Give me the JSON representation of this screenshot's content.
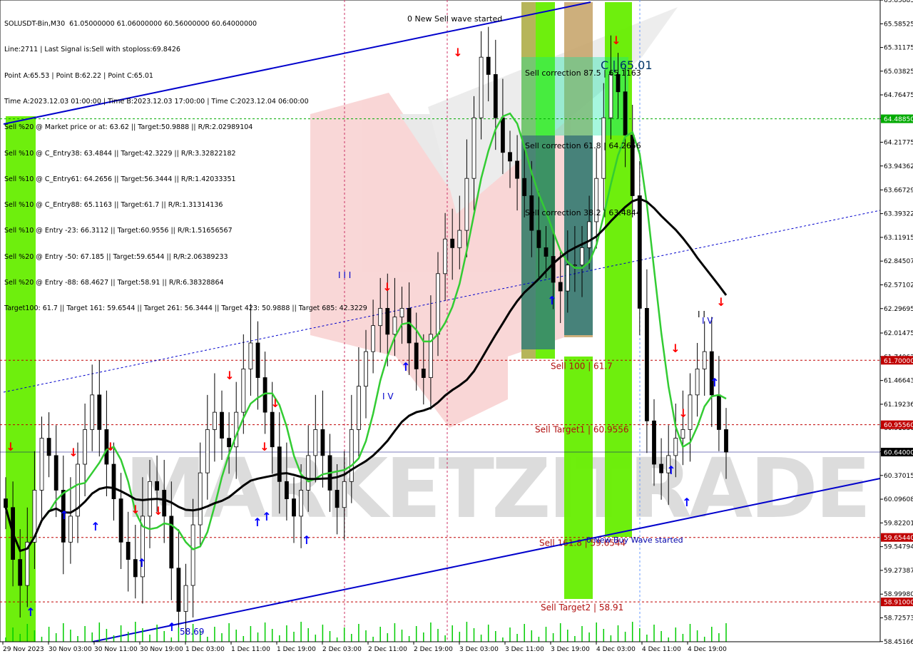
{
  "header": {
    "lines": [
      "SOLUSDT-Bin,M30  61.05000000 61.06000000 60.56000000 60.64000000",
      "Line:2711 | Last Signal is:Sell with stoploss:69.8426",
      "Point A:65.53 | Point B:62.22 | Point C:65.01",
      "Time A:2023.12.03 01:00:00 | Time B:2023.12.03 17:00:00 | Time C:2023.12.04 06:00:00",
      "Sell %20 @ Market price or at: 63.62 || Target:50.9888 || R/R:2.02989104",
      "Sell %10 @ C_Entry38: 63.4844 || Target:42.3229 || R/R:3.32822182",
      "Sell %10 @ C_Entry61: 64.2656 || Target:56.3444 || R/R:1.42033351",
      "Sell %10 @ C_Entry88: 65.1163 || Target:61.7 || R/R:1.31314136",
      "Sell %10 @ Entry -23: 66.3112 || Target:60.9556 || R/R:1.51656567",
      "Sell %20 @ Entry -50: 67.185 || Target:59.6544 || R/R:2.06389233",
      "Sell %20 @ Entry -88: 68.4627 || Target:58.91 || R/R:6.38328864",
      "Target100: 61.7 || Target 161: 59.6544 || Target 261: 56.3444 || Target 423: 50.9888 || Target 685: 42.3229"
    ]
  },
  "watermark": {
    "text": "MARKETZITRADE"
  },
  "colors": {
    "bg": "#ffffff",
    "bull": "#00a000",
    "bear": "#ff0000",
    "wick": "#000000",
    "green_band": "#66ee00",
    "tan_band": "#c8a66e",
    "teal_band": "#2f7a7a",
    "ma_fast": "#33cc33",
    "ma_slow": "#000000",
    "channel": "#0000cc",
    "level_red": "#c00000",
    "level_green": "#00aa00",
    "arrow_up": "#0000ff",
    "arrow_down": "#ff0000"
  },
  "chart_data": {
    "type": "candlestick",
    "symbol": "SOLUSDT-Bin",
    "timeframe": "M30",
    "ylim": [
      58.45,
      65.86
    ],
    "y_ticks": [
      "65.858850",
      "65.585250",
      "65.311750",
      "65.038250",
      "64.764750",
      "64.491250",
      "64.217750",
      "63.943625",
      "63.667299",
      "63.393225",
      "63.119150",
      "62.845075",
      "62.571025",
      "62.296950",
      "62.014750",
      "61.740675",
      "61.466430",
      "61.192365",
      "60.918300",
      "60.644225",
      "60.370155",
      "60.096080",
      "59.822010",
      "59.547940",
      "59.273870",
      "58.999800",
      "58.725735",
      "58.451665"
    ],
    "x_labels": [
      "29 Nov 2023",
      "30 Nov 03:00",
      "30 Nov 11:00",
      "30 Nov 19:00",
      "1 Dec 03:00",
      "1 Dec 11:00",
      "1 Dec 19:00",
      "2 Dec 03:00",
      "2 Dec 11:00",
      "2 Dec 19:00",
      "3 Dec 03:00",
      "3 Dec 11:00",
      "3 Dec 19:00",
      "4 Dec 03:00",
      "4 Dec 11:00",
      "4 Dec 19:00"
    ],
    "price_tags": [
      {
        "label": "61.70000",
        "value": 61.7,
        "color": "#c00000"
      },
      {
        "label": "60.95560",
        "value": 60.9556,
        "color": "#c00000"
      },
      {
        "label": "60.64000",
        "value": 60.64,
        "color": "#000000"
      },
      {
        "label": "59.65440",
        "value": 59.6544,
        "color": "#c00000"
      },
      {
        "label": "58.91000",
        "value": 58.91,
        "color": "#c00000"
      },
      {
        "label": "64.48850",
        "value": 64.4885,
        "color": "#00aa00"
      }
    ],
    "levels": [
      {
        "value": 61.7,
        "color": "#c00000",
        "label": "Sell 100 | 61.7"
      },
      {
        "value": 60.9556,
        "color": "#c00000",
        "label": "Sell Target1 | 60.9556"
      },
      {
        "value": 60.64,
        "color": "#000080",
        "label": ""
      },
      {
        "value": 59.6544,
        "color": "#c00000",
        "label": "Sell 161.8 | 59.6544"
      },
      {
        "value": 58.91,
        "color": "#c00000",
        "label": "Sell Target2 | 58.91"
      },
      {
        "value": 64.4885,
        "color": "#00aa00",
        "label": ""
      }
    ],
    "annotations": [
      {
        "text": "0 New Sell wave started"
      },
      {
        "text": "Sell correction 87.5 | 65.1163"
      },
      {
        "text": "Sell correction 61.8 | 64.2656"
      },
      {
        "text": "Sell correction 38.2 | 63.4844"
      },
      {
        "text": "C | 65.01"
      },
      {
        "text": "0 New Buy Wave started"
      },
      {
        "text": "I V"
      },
      {
        "text": "I I"
      },
      {
        "text": "I V"
      },
      {
        "text": "I I I"
      },
      {
        "text": "58.69"
      }
    ],
    "close_series": [
      60.0,
      59.4,
      59.1,
      59.6,
      60.2,
      60.8,
      60.6,
      60.2,
      59.6,
      59.9,
      60.5,
      60.9,
      61.3,
      60.9,
      60.5,
      60.1,
      59.6,
      59.4,
      59.2,
      59.9,
      60.3,
      60.2,
      59.9,
      59.3,
      58.8,
      59.1,
      59.8,
      60.4,
      60.9,
      61.1,
      60.8,
      60.7,
      61.1,
      61.6,
      61.9,
      61.5,
      61.1,
      60.7,
      60.3,
      60.1,
      59.9,
      60.2,
      60.6,
      60.9,
      60.6,
      60.2,
      60.0,
      60.3,
      60.9,
      61.4,
      61.8,
      62.1,
      62.3,
      62.0,
      62.2,
      62.3,
      61.9,
      61.6,
      61.5,
      62.0,
      62.7,
      63.1,
      63.0,
      63.2,
      63.8,
      64.5,
      65.2,
      65.0,
      64.5,
      64.1,
      64.0,
      63.8,
      63.6,
      63.2,
      63.0,
      62.9,
      62.6,
      62.5,
      62.8,
      62.8,
      63.0,
      63.3,
      63.8,
      64.5,
      65.0,
      64.8,
      64.3,
      63.6,
      62.3,
      61.0,
      60.5,
      60.4,
      60.6,
      60.8,
      60.9,
      61.3,
      61.6,
      61.8,
      61.3,
      60.9,
      60.64
    ]
  }
}
